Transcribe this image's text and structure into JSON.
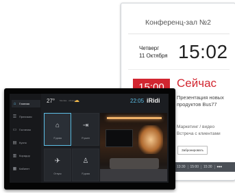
{
  "meeting_display": {
    "room_title": "Конференц-зал №2",
    "weekday": "Четверг",
    "date": "11 Октября",
    "time": "15:02",
    "current_start": "15:00",
    "status": "Сейчас",
    "presentation_line1": "Презентация новых",
    "presentation_line2": "продуктов Bus77",
    "next_line1": "Маркетинг / видео",
    "next_line2": "Встреча с клиентами",
    "book_button": "Забронировать",
    "time_slots": [
      "13:30",
      "15:00",
      "15:30"
    ],
    "more": "•••",
    "accent_color": "#d22630"
  },
  "home_panel": {
    "nav": [
      {
        "icon": "home-icon",
        "glyph": "⌂",
        "label": "Главная"
      },
      {
        "icon": "scenario-icon",
        "glyph": "☰",
        "label": "Прихожая"
      },
      {
        "icon": "living-room-icon",
        "glyph": "▭",
        "label": "Гостиная"
      },
      {
        "icon": "kitchen-icon",
        "glyph": "▤",
        "label": "Кухня"
      },
      {
        "icon": "bedroom-icon",
        "glyph": "▥",
        "label": "Коридор"
      },
      {
        "icon": "cabinet-icon",
        "glyph": "▦",
        "label": "Кабинет"
      }
    ],
    "temperature": "27°",
    "weather_small": "Москва · облачно",
    "weather_icon": "sun-cloud-icon",
    "clock": "22:05",
    "brand": "iRidi",
    "tiles": [
      {
        "icon": "home-icon",
        "glyph": "⌂",
        "label": "Я дома"
      },
      {
        "icon": "leave-home-icon",
        "glyph": "⇥",
        "label": "Я ушел"
      },
      {
        "icon": "plane-icon",
        "glyph": "✈",
        "label": "Отпуск"
      },
      {
        "icon": "guests-icon",
        "glyph": "♙",
        "label": "Я дома"
      }
    ],
    "accent_color": "#5ec0e8"
  }
}
